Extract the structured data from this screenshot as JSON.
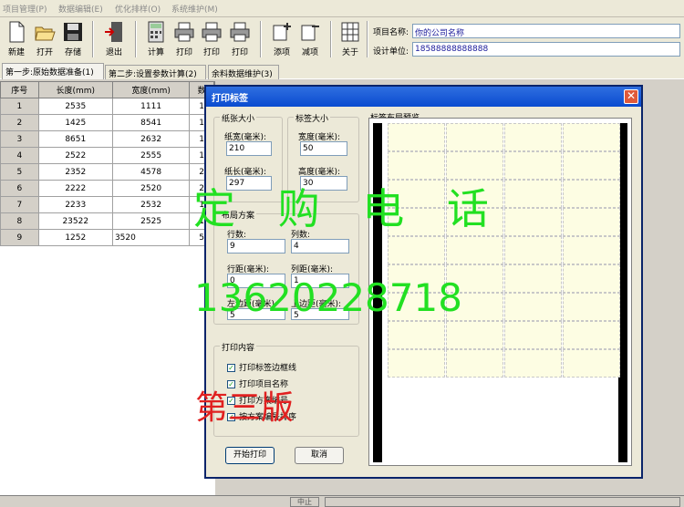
{
  "menu": [
    "项目管理(P)",
    "数据编辑(E)",
    "优化排样(O)",
    "系统维护(M)"
  ],
  "toolbar": {
    "buttons": [
      {
        "label": "新建",
        "icon": "new-file-icon"
      },
      {
        "label": "打开",
        "icon": "open-folder-icon"
      },
      {
        "label": "存储",
        "icon": "save-disk-icon"
      },
      {
        "label": "退出",
        "icon": "exit-door-icon"
      },
      {
        "label": "计算",
        "icon": "calculator-icon"
      },
      {
        "label": "打印",
        "icon": "printer-icon"
      },
      {
        "label": "打印",
        "icon": "printer-icon"
      },
      {
        "label": "打印",
        "icon": "printer-icon"
      },
      {
        "label": "添项",
        "icon": "add-item-icon"
      },
      {
        "label": "减项",
        "icon": "remove-item-icon"
      },
      {
        "label": "关于",
        "icon": "about-grid-icon"
      }
    ]
  },
  "project": {
    "name_label": "项目名称:",
    "name_value": "你的公司名称",
    "unit_label": "设计单位:",
    "unit_value": "18588888888888"
  },
  "tabs": [
    {
      "label": "第一步:原始数据准备(1)",
      "active": true
    },
    {
      "label": "第二步:设置参数计算(2)",
      "active": false
    },
    {
      "label": "余料数据维护(3)",
      "active": false
    }
  ],
  "grid": {
    "headers": [
      "序号",
      "长度(mm)",
      "宽度(mm)",
      "数"
    ],
    "rows": [
      [
        "1",
        "2535",
        "1111",
        "1"
      ],
      [
        "2",
        "1425",
        "8541",
        "1"
      ],
      [
        "3",
        "8651",
        "2632",
        "1"
      ],
      [
        "4",
        "2522",
        "2555",
        "1"
      ],
      [
        "5",
        "2352",
        "4578",
        "2"
      ],
      [
        "6",
        "2222",
        "2520",
        "2"
      ],
      [
        "7",
        "2233",
        "2532",
        "1"
      ],
      [
        "8",
        "23522",
        "2525",
        "1"
      ],
      [
        "9",
        "1252",
        "3520",
        "5"
      ]
    ]
  },
  "dialog": {
    "title": "打印标签",
    "paper_size": {
      "title": "纸张大小",
      "width_label": "纸宽(毫米):",
      "width_value": "210",
      "length_label": "纸长(毫米):",
      "length_value": "297"
    },
    "label_size": {
      "title": "标签大小",
      "width_label": "宽度(毫米):",
      "width_value": "50",
      "height_label": "高度(毫米):",
      "height_value": "30"
    },
    "layout": {
      "title": "布局方案",
      "rows_label": "行数:",
      "rows_value": "9",
      "cols_label": "列数:",
      "cols_value": "4",
      "row_gap_label": "行距(毫米):",
      "row_gap_value": "0",
      "col_gap_label": "列距(毫米):",
      "col_gap_value": "1",
      "left_margin_label": "左边距(毫米):",
      "left_margin_value": "5",
      "top_margin_label": "上边距(毫米):",
      "top_margin_value": "5"
    },
    "content": {
      "title": "打印内容",
      "options": [
        {
          "label": "打印标签边框线",
          "checked": true
        },
        {
          "label": "打印项目名称",
          "checked": true
        },
        {
          "label": "打印方案编号",
          "checked": true
        },
        {
          "label": "按方案编号排序",
          "checked": true
        }
      ]
    },
    "preview_title": "标签布局预览",
    "start_button": "开始打印",
    "cancel_button": "取消"
  },
  "watermarks": {
    "order_phone_label": "定 购 电 话",
    "phone_number": "13620228718",
    "edition": "第三版"
  },
  "status": {
    "center": "中止"
  },
  "colors": {
    "watermark_green": "#22e022",
    "watermark_red": "#e02020",
    "title_blue": "#0a4bd0"
  }
}
